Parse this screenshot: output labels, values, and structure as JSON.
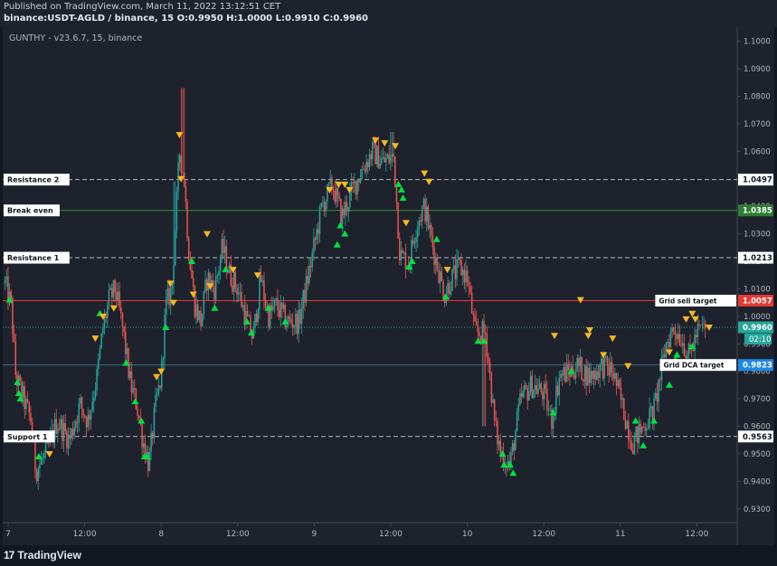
{
  "header": {
    "published": "Published on TradingView.com, March 11, 2022 13:12:51 CET",
    "symbol_line": "binance:USDT-AGLD / binance, 15 O:0.9950 H:1.0000 L:0.9910 C:0.9960"
  },
  "indicator_label": "GUNTHY - v23.6.7, 15, binance",
  "footer": {
    "brand": "TradingView",
    "brand_mark": "17"
  },
  "colors": {
    "background": "#1e222d",
    "grid": "#2a2e39",
    "up": "#26a69a",
    "down": "#ef5350",
    "buy_marker": "#00e040",
    "sell_marker": "#f5b921",
    "axis_text": "#b2b5be"
  },
  "chart_data": {
    "type": "candlestick",
    "timeframe": "15",
    "ylim": [
      0.925,
      1.103
    ],
    "y_ticks": [
      "1.1000",
      "1.0900",
      "1.0800",
      "1.0700",
      "1.0600",
      "1.0500",
      "1.0400",
      "1.0300",
      "1.0200",
      "1.0100",
      "1.0000",
      "0.9900",
      "0.9800",
      "0.9700",
      "0.9600",
      "0.9500",
      "0.9400",
      "0.9300"
    ],
    "x_ticks": [
      {
        "label": "7",
        "day": 0
      },
      {
        "label": "12:00",
        "day": 0.5
      },
      {
        "label": "8",
        "day": 1
      },
      {
        "label": "12:00",
        "day": 1.5
      },
      {
        "label": "9",
        "day": 2
      },
      {
        "label": "12:00",
        "day": 2.5
      },
      {
        "label": "10",
        "day": 3
      },
      {
        "label": "12:00",
        "day": 3.5
      },
      {
        "label": "11",
        "day": 4
      },
      {
        "label": "12:00",
        "day": 4.5
      }
    ],
    "price_path": [
      [
        -0.02,
        1.012
      ],
      [
        0.02,
        1.004
      ],
      [
        0.05,
        0.978
      ],
      [
        0.1,
        0.97
      ],
      [
        0.15,
        0.962
      ],
      [
        0.18,
        0.944
      ],
      [
        0.25,
        0.95
      ],
      [
        0.32,
        0.962
      ],
      [
        0.4,
        0.955
      ],
      [
        0.47,
        0.968
      ],
      [
        0.52,
        0.962
      ],
      [
        0.58,
        0.978
      ],
      [
        0.62,
        0.996
      ],
      [
        0.66,
        1.006
      ],
      [
        0.7,
        1.01
      ],
      [
        0.75,
        0.995
      ],
      [
        0.8,
        0.975
      ],
      [
        0.84,
        0.968
      ],
      [
        0.88,
        0.955
      ],
      [
        0.92,
        0.946
      ],
      [
        0.96,
        0.966
      ],
      [
        1.0,
        0.978
      ],
      [
        1.03,
        1.004
      ],
      [
        1.07,
        1.01
      ],
      [
        1.12,
        1.06
      ],
      [
        1.15,
        1.05
      ],
      [
        1.18,
        1.024
      ],
      [
        1.22,
        1.004
      ],
      [
        1.26,
        0.998
      ],
      [
        1.3,
        1.014
      ],
      [
        1.35,
        1.01
      ],
      [
        1.4,
        1.025
      ],
      [
        1.45,
        1.015
      ],
      [
        1.5,
        1.01
      ],
      [
        1.55,
        1.0
      ],
      [
        1.6,
        0.992
      ],
      [
        1.65,
        1.014
      ],
      [
        1.7,
        1.0
      ],
      [
        1.75,
        1.004
      ],
      [
        1.82,
        0.998
      ],
      [
        1.9,
        0.998
      ],
      [
        1.98,
        1.02
      ],
      [
        2.05,
        1.04
      ],
      [
        2.12,
        1.048
      ],
      [
        2.18,
        1.036
      ],
      [
        2.25,
        1.046
      ],
      [
        2.3,
        1.052
      ],
      [
        2.38,
        1.06
      ],
      [
        2.45,
        1.056
      ],
      [
        2.52,
        1.058
      ],
      [
        2.56,
        1.022
      ],
      [
        2.62,
        1.02
      ],
      [
        2.67,
        1.034
      ],
      [
        2.72,
        1.04
      ],
      [
        2.78,
        1.024
      ],
      [
        2.85,
        1.008
      ],
      [
        2.9,
        1.014
      ],
      [
        2.95,
        1.018
      ],
      [
        3.0,
        1.014
      ],
      [
        3.05,
        0.994
      ],
      [
        3.12,
        0.994
      ],
      [
        3.18,
        0.96
      ],
      [
        3.22,
        0.95
      ],
      [
        3.28,
        0.946
      ],
      [
        3.35,
        0.97
      ],
      [
        3.42,
        0.975
      ],
      [
        3.5,
        0.972
      ],
      [
        3.55,
        0.962
      ],
      [
        3.6,
        0.978
      ],
      [
        3.67,
        0.98
      ],
      [
        3.72,
        0.982
      ],
      [
        3.8,
        0.978
      ],
      [
        3.88,
        0.982
      ],
      [
        3.95,
        0.98
      ],
      [
        4.02,
        0.966
      ],
      [
        4.08,
        0.954
      ],
      [
        4.15,
        0.96
      ],
      [
        4.22,
        0.966
      ],
      [
        4.3,
        0.99
      ],
      [
        4.35,
        0.996
      ],
      [
        4.4,
        0.992
      ],
      [
        4.45,
        0.985
      ],
      [
        4.5,
        0.994
      ],
      [
        4.55,
        0.996
      ]
    ],
    "candle_count": 466,
    "buy_markers": [
      [
        0.01,
        1.006
      ],
      [
        0.06,
        0.976
      ],
      [
        0.07,
        0.972
      ],
      [
        0.08,
        0.97
      ],
      [
        0.2,
        0.949
      ],
      [
        0.6,
        1.001
      ],
      [
        0.77,
        0.983
      ],
      [
        0.83,
        0.969
      ],
      [
        0.87,
        0.962
      ],
      [
        0.89,
        0.949
      ],
      [
        0.91,
        0.949
      ],
      [
        1.03,
        0.996
      ],
      [
        1.2,
        1.02
      ],
      [
        1.35,
        1.003
      ],
      [
        1.42,
        1.017
      ],
      [
        1.56,
        0.998
      ],
      [
        1.59,
        0.994
      ],
      [
        1.7,
        1.003
      ],
      [
        1.81,
        0.998
      ],
      [
        2.15,
        1.026
      ],
      [
        2.17,
        1.033
      ],
      [
        2.2,
        1.03
      ],
      [
        2.55,
        1.048
      ],
      [
        2.57,
        1.046
      ],
      [
        2.58,
        1.043
      ],
      [
        2.62,
        1.018
      ],
      [
        2.64,
        1.02
      ],
      [
        2.8,
        1.028
      ],
      [
        2.86,
        1.007
      ],
      [
        3.07,
        0.991
      ],
      [
        3.11,
        0.991
      ],
      [
        3.23,
        0.95
      ],
      [
        3.24,
        0.946
      ],
      [
        3.28,
        0.946
      ],
      [
        3.3,
        0.943
      ],
      [
        3.56,
        0.965
      ],
      [
        3.68,
        0.98
      ],
      [
        4.1,
        0.962
      ],
      [
        4.15,
        0.953
      ],
      [
        4.22,
        0.962
      ],
      [
        4.32,
        0.975
      ],
      [
        4.36,
        0.984
      ],
      [
        4.37,
        0.986
      ],
      [
        4.47,
        0.989
      ]
    ],
    "sell_markers": [
      [
        0.27,
        0.95
      ],
      [
        0.57,
        0.992
      ],
      [
        0.62,
        1.0
      ],
      [
        0.69,
        1.003
      ],
      [
        0.97,
        0.978
      ],
      [
        1.0,
        0.98
      ],
      [
        1.06,
        1.012
      ],
      [
        1.08,
        1.005
      ],
      [
        1.12,
        1.066
      ],
      [
        1.13,
        1.05
      ],
      [
        1.21,
        1.008
      ],
      [
        1.3,
        1.03
      ],
      [
        1.32,
        1.011
      ],
      [
        1.47,
        1.017
      ],
      [
        1.63,
        1.015
      ],
      [
        2.1,
        1.046
      ],
      [
        2.16,
        1.048
      ],
      [
        2.2,
        1.048
      ],
      [
        2.23,
        1.046
      ],
      [
        2.4,
        1.064
      ],
      [
        2.46,
        1.063
      ],
      [
        2.53,
        1.062
      ],
      [
        2.6,
        1.034
      ],
      [
        2.72,
        1.052
      ],
      [
        2.75,
        1.049
      ],
      [
        2.87,
        1.017
      ],
      [
        3.57,
        0.993
      ],
      [
        3.74,
        1.006
      ],
      [
        3.79,
        0.993
      ],
      [
        3.8,
        0.995
      ],
      [
        3.89,
        0.986
      ],
      [
        3.95,
        0.992
      ],
      [
        4.05,
        0.982
      ],
      [
        4.32,
        0.987
      ],
      [
        4.43,
        0.999
      ],
      [
        4.47,
        1.001
      ],
      [
        4.49,
        0.999
      ],
      [
        4.58,
        0.996
      ]
    ],
    "horizontal_lines": [
      {
        "label": "Resistance 2",
        "price": 1.0497,
        "price_label": "1.0497",
        "style": "dashed",
        "color": "#b2b5be",
        "left_tag": true,
        "tag_color": "#ffffff",
        "tag_text_color": "#131722"
      },
      {
        "label": "Break even",
        "price": 1.0385,
        "price_label": "1.0385",
        "style": "solid",
        "color": "#2a8f3c",
        "left_tag": true,
        "tag_color": "#ffffff",
        "tag_text_color": "#131722",
        "price_bg": "#2e7d32"
      },
      {
        "label": "Resistance 1",
        "price": 1.0213,
        "price_label": "1.0213",
        "style": "dashed",
        "color": "#b2b5be",
        "left_tag": true,
        "tag_color": "#ffffff",
        "tag_text_color": "#131722"
      },
      {
        "label": "Grid sell target",
        "price": 1.0057,
        "price_label": "1.0057",
        "style": "solid",
        "color": "#e53935",
        "left_tag": false,
        "tag_color": "#ffffff",
        "tag_text_color": "#131722",
        "price_bg": "#e53935"
      },
      {
        "label": "",
        "price": 0.996,
        "price_label": "0.9960",
        "style": "dotted",
        "color": "#26a69a",
        "left_tag": false,
        "price_bg": "#26a69a"
      },
      {
        "label": "Grid DCA target",
        "price": 0.9823,
        "price_label": "0.9823",
        "style": "solid",
        "color": "#2f6d8a",
        "left_tag": false,
        "tag_color": "#ffffff",
        "tag_text_color": "#131722",
        "price_bg": "#1e88e5"
      },
      {
        "label": "Support 1",
        "price": 0.9563,
        "price_label": "0.9563",
        "style": "dashed",
        "color": "#b2b5be",
        "left_tag": true,
        "tag_color": "#ffffff",
        "tag_text_color": "#131722"
      }
    ],
    "countdown": "02:10",
    "grid": false
  }
}
